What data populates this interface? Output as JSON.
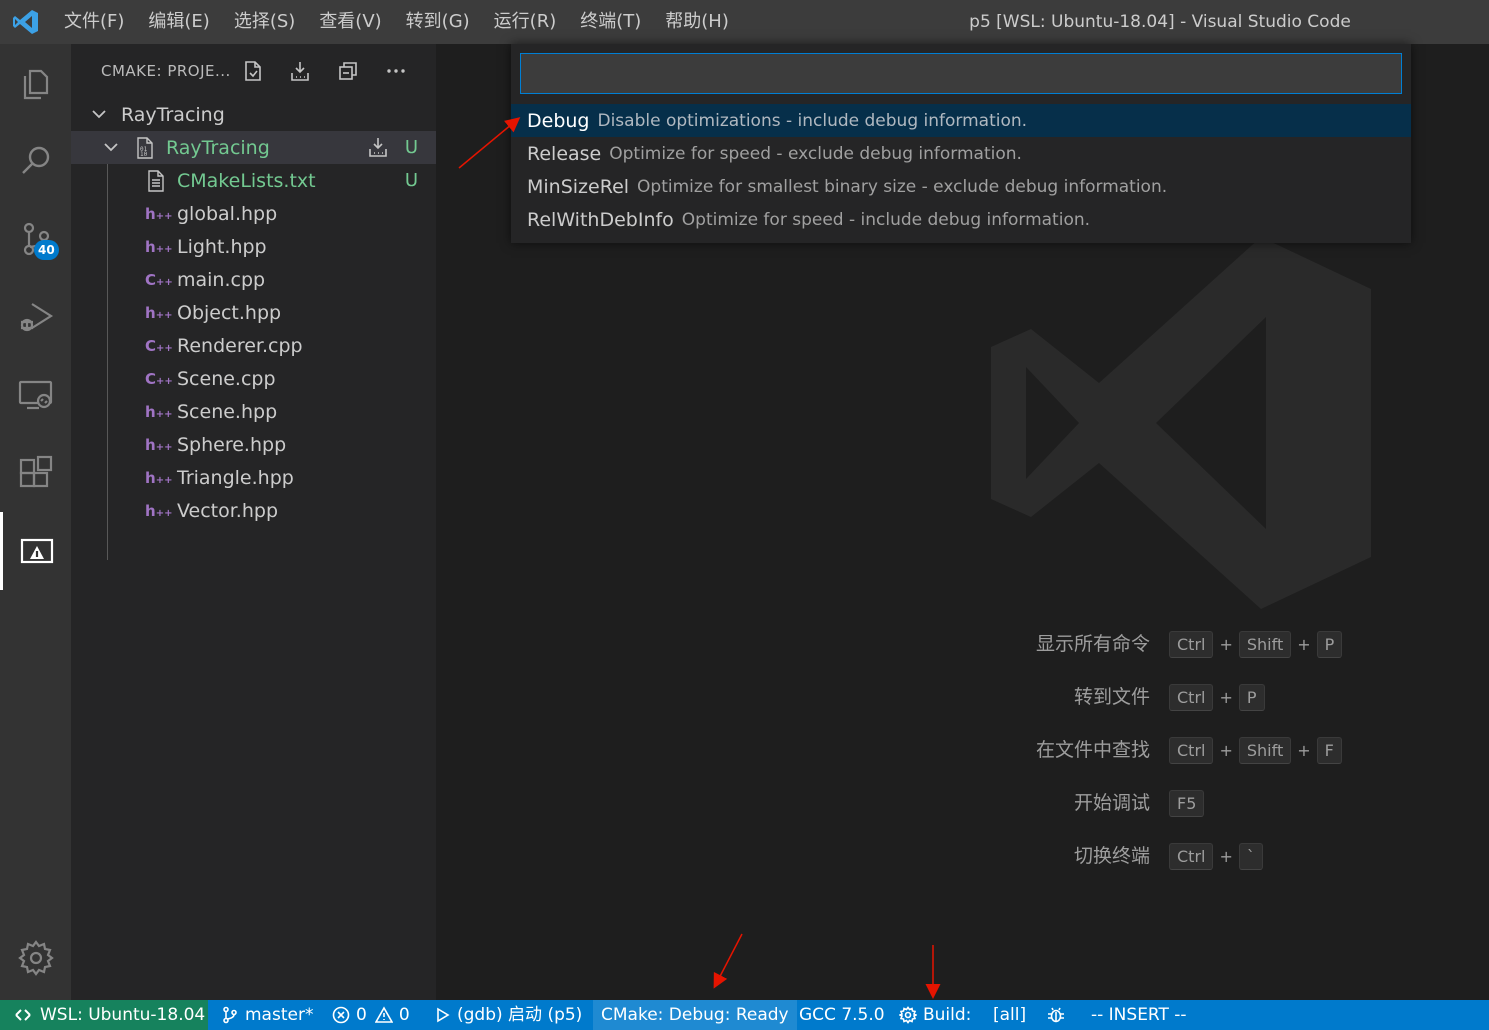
{
  "window": {
    "title": "p5 [WSL: Ubuntu-18.04] - Visual Studio Code"
  },
  "menu": [
    "文件(F)",
    "编辑(E)",
    "选择(S)",
    "查看(V)",
    "转到(G)",
    "运行(R)",
    "终端(T)",
    "帮助(H)"
  ],
  "activity_bar": {
    "items": [
      "explorer-icon",
      "search-icon",
      "source-control-icon",
      "run-debug-icon",
      "remote-explorer-icon",
      "extensions-icon",
      "cmake-icon"
    ],
    "scm_badge": "40",
    "active": "cmake-icon",
    "bottom": "gear-icon"
  },
  "sidebar": {
    "title": "CMAKE: PROJE...",
    "tree": {
      "root": "RayTracing",
      "target": "RayTracing",
      "target_status": "U",
      "files": [
        {
          "name": "CMakeLists.txt",
          "type": "txt",
          "status": "U"
        },
        {
          "name": "global.hpp",
          "type": "hpp"
        },
        {
          "name": "Light.hpp",
          "type": "hpp"
        },
        {
          "name": "main.cpp",
          "type": "cpp"
        },
        {
          "name": "Object.hpp",
          "type": "hpp"
        },
        {
          "name": "Renderer.cpp",
          "type": "cpp"
        },
        {
          "name": "Scene.cpp",
          "type": "cpp"
        },
        {
          "name": "Scene.hpp",
          "type": "hpp"
        },
        {
          "name": "Sphere.hpp",
          "type": "hpp"
        },
        {
          "name": "Triangle.hpp",
          "type": "hpp"
        },
        {
          "name": "Vector.hpp",
          "type": "hpp"
        }
      ]
    }
  },
  "quick_pick": {
    "input_value": "",
    "items": [
      {
        "label": "Debug",
        "description": "Disable optimizations - include debug information.",
        "selected": true
      },
      {
        "label": "Release",
        "description": "Optimize for speed - exclude debug information."
      },
      {
        "label": "MinSizeRel",
        "description": "Optimize for smallest binary size - exclude debug information."
      },
      {
        "label": "RelWithDebInfo",
        "description": "Optimize for speed - include debug information."
      }
    ]
  },
  "editor": {
    "shortcuts": [
      {
        "label": "显示所有命令",
        "keys": [
          "Ctrl",
          "Shift",
          "P"
        ]
      },
      {
        "label": "转到文件",
        "keys": [
          "Ctrl",
          "P"
        ]
      },
      {
        "label": "在文件中查找",
        "keys": [
          "Ctrl",
          "Shift",
          "F"
        ]
      },
      {
        "label": "开始调试",
        "keys": [
          "F5"
        ]
      },
      {
        "label": "切换终端",
        "keys": [
          "Ctrl",
          "`"
        ]
      }
    ]
  },
  "statusbar": {
    "remote": "WSL: Ubuntu-18.04",
    "branch": "master*",
    "errors": "0",
    "warnings": "0",
    "launch": "(gdb) 启动 (p5)",
    "cmake": "CMake: Debug: Ready",
    "kit": "GCC 7.5.0",
    "build_label": "Build:",
    "build_target": "[all]",
    "mode": "-- INSERT --"
  },
  "colors": {
    "accent": "#007acc",
    "remote": "#16825d",
    "git_untracked": "#73c991",
    "cpp_icon": "#a074c4",
    "annotation_arrow": "#e51400"
  }
}
